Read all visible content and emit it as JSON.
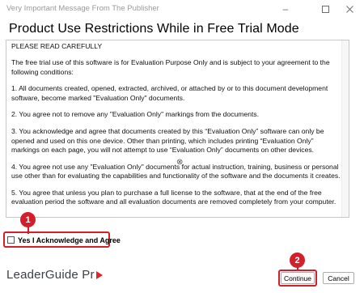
{
  "window": {
    "title": "Very Important Message From The Publisher",
    "controls": [
      "minimize-icon",
      "maximize-icon",
      "close-icon"
    ]
  },
  "heading": "Product Use Restrictions While in Free Trial Mode",
  "content": {
    "paragraphs": [
      "PLEASE READ CAREFULLY",
      "The free trial use of this software is for Evaluation Purpose Only and is subject to your agreement to the following conditions:",
      "1. All documents created, opened, extracted, archived, or attached by or to this document development software, become marked \"Evaluation Only\" documents.",
      "2. You agree not to remove any \"Evaluation Only\" markings from the documents.",
      "3. You acknowledge and agree that documents created by this “Evaluation Only” software can only be opened and used on this one device. Other than printing, which includes printing “Evaluation Only” markings on each page, you will not attempt to use “Evaluation Only” documents on other devices.",
      "4. You agree not use any \"Evaluation Only\" documents for actual instruction, training, business or personal use other than for evaluating the capabilities and functionality of the software and the documents it creates.",
      "5. You agree that unless you plan to purchase a full license to the software, that at the end of the free evaluation period the software and all evaluation documents are removed completely from your computer."
    ]
  },
  "acknowledge": {
    "label": "Yes I Acknowledge and Agree",
    "checked": false
  },
  "logo": {
    "text": "LeaderGuide Pr",
    "accent_color": "#e2232a"
  },
  "buttons": {
    "continue": "Continue",
    "cancel": "Cancel"
  },
  "callouts": [
    "1",
    "2"
  ],
  "colors": {
    "callout": "#d21f2b",
    "title_text": "#9a9a9a"
  }
}
